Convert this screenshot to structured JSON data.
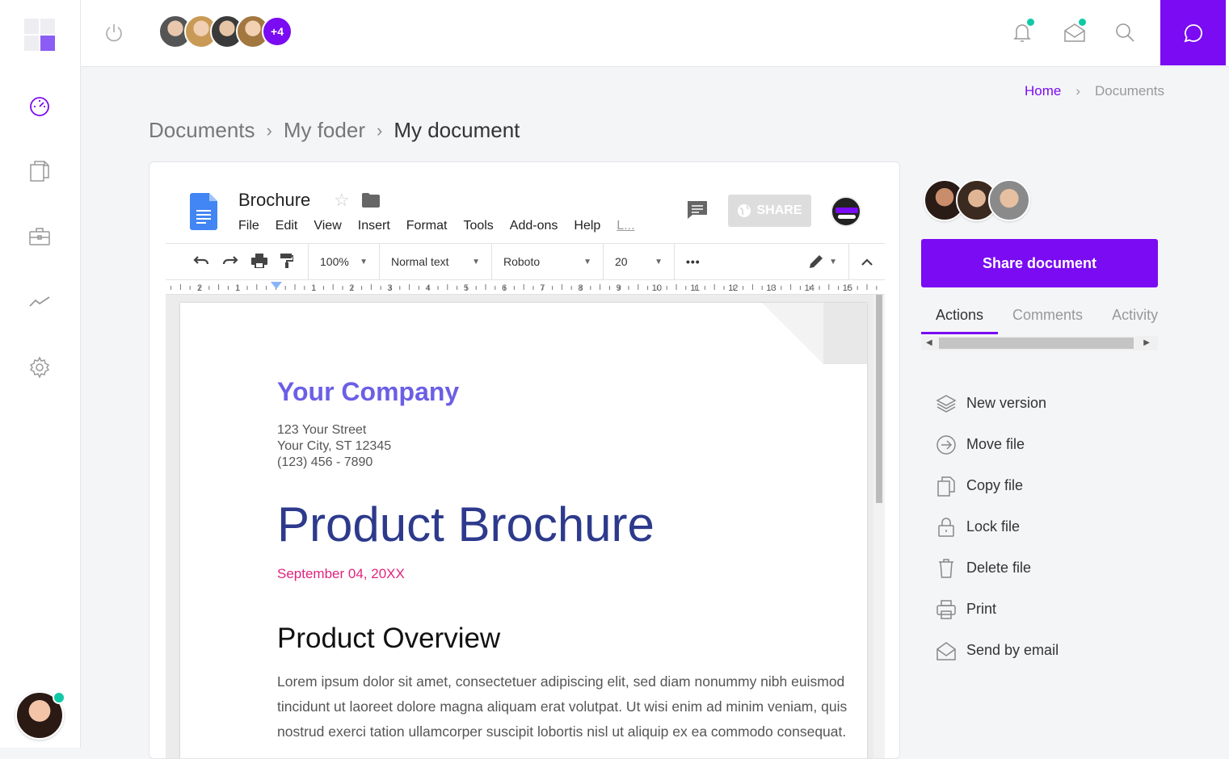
{
  "topbar": {
    "team_more": "+4",
    "chat_icon": "chat-icon"
  },
  "breadcrumb_top": {
    "home": "Home",
    "current": "Documents"
  },
  "breadcrumb_main": {
    "items": [
      "Documents",
      "My foder",
      "My document"
    ]
  },
  "doc": {
    "title": "Brochure",
    "menu": [
      "File",
      "Edit",
      "View",
      "Insert",
      "Format",
      "Tools",
      "Add-ons",
      "Help",
      "L..."
    ],
    "share_label": "SHARE",
    "toolbar": {
      "zoom": "100%",
      "style": "Normal text",
      "font": "Roboto",
      "size": "20",
      "more": "•••"
    },
    "ruler_labels": [
      "2",
      "1",
      "1",
      "2",
      "3",
      "4",
      "5",
      "6",
      "7",
      "8",
      "9",
      "10",
      "11",
      "12",
      "13",
      "14",
      "15"
    ],
    "content": {
      "company": "Your Company",
      "address": [
        "123 Your Street",
        "Your City, ST 12345",
        "(123) 456 - 7890"
      ],
      "title": "Product Brochure",
      "date": "September 04, 20XX",
      "section": "Product Overview",
      "lorem": [
        "Lorem ipsum dolor sit amet, consectetuer adipiscing elit, sed diam nonummy nibh euismod",
        "tincidunt ut laoreet dolore magna aliquam erat volutpat. Ut wisi enim ad minim veniam, quis",
        "nostrud exerci tation ullamcorper suscipit lobortis nisl ut aliquip ex ea commodo consequat."
      ]
    }
  },
  "panel": {
    "share_button": "Share document",
    "tabs": [
      "Actions",
      "Comments",
      "Activity"
    ],
    "actions": [
      {
        "label": "New version",
        "icon": "layers-icon"
      },
      {
        "label": "Move file",
        "icon": "arrow-circle-icon"
      },
      {
        "label": "Copy file",
        "icon": "copy-icon"
      },
      {
        "label": "Lock file",
        "icon": "lock-icon"
      },
      {
        "label": "Delete file",
        "icon": "trash-icon"
      },
      {
        "label": "Print",
        "icon": "printer-icon"
      },
      {
        "label": "Send by email",
        "icon": "envelope-icon"
      }
    ]
  },
  "colors": {
    "accent": "#7a0bf2",
    "notification": "#10c9a5",
    "company": "#6b5fe6",
    "title": "#2d3a8c",
    "date": "#e0247d"
  }
}
